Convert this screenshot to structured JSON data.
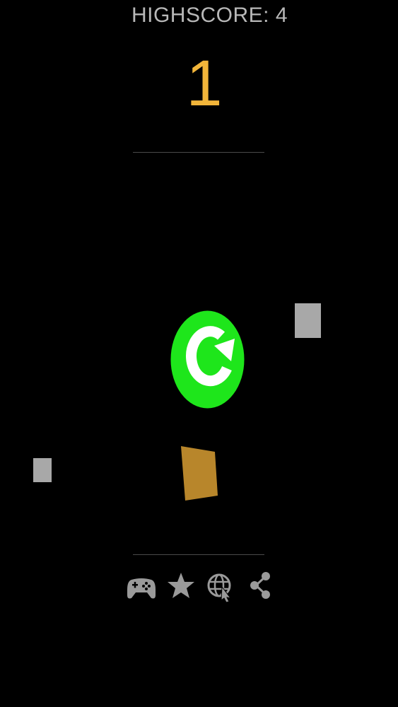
{
  "hud": {
    "highscore_text": "HIGHSCORE: 4",
    "score": "1"
  },
  "colors": {
    "background": "#000000",
    "highscore_text": "#b8b8b8",
    "score": "#f2b53a",
    "restart_button": "#1ee61b",
    "restart_arrow": "#ffffff",
    "obstacle": "#a8a8a8",
    "player": "#b8862b",
    "toolbar_icon": "#9a9a9a",
    "divider": "#4a4a4a"
  },
  "objects": {
    "restart_button": "restart-icon",
    "player": "player-block",
    "obstacles": [
      "gray-block",
      "gray-block"
    ]
  },
  "toolbar": {
    "icons": [
      "gamepad-icon",
      "star-icon",
      "web-icon",
      "share-icon"
    ]
  }
}
